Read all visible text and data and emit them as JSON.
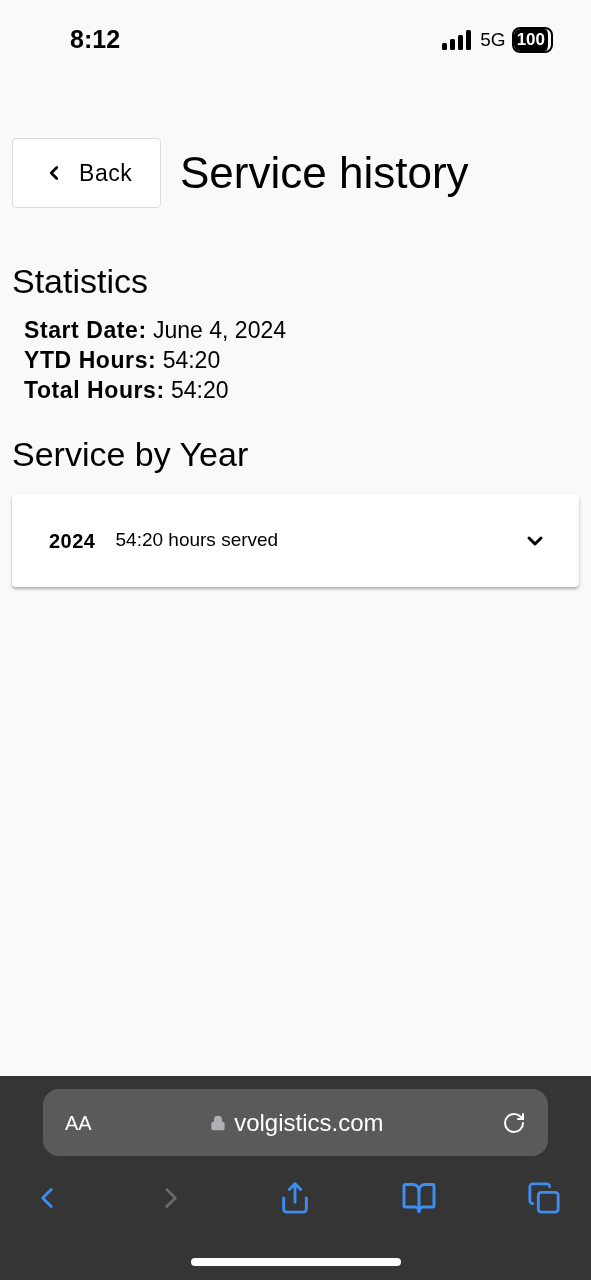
{
  "status_bar": {
    "time": "8:12",
    "network": "5G",
    "battery": "100"
  },
  "header": {
    "back_button": "Back",
    "title": "Service history"
  },
  "statistics": {
    "heading": "Statistics",
    "rows": [
      {
        "label": "Start Date:",
        "value": "June 4, 2024"
      },
      {
        "label": "YTD Hours:",
        "value": "54:20"
      },
      {
        "label": "Total Hours:",
        "value": "54:20"
      }
    ]
  },
  "service_by_year": {
    "heading": "Service by Year",
    "items": [
      {
        "year": "2024",
        "summary": "54:20 hours served",
        "expanded": false
      }
    ]
  },
  "browser": {
    "text_size_button": "AA",
    "url": "volgistics.com",
    "back_enabled": true,
    "forward_enabled": false
  }
}
